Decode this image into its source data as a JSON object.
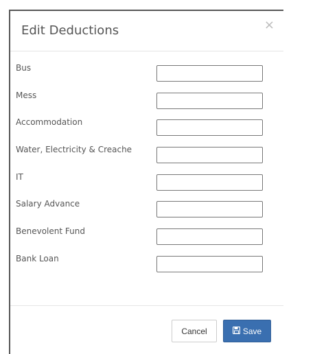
{
  "modal": {
    "title": "Edit Deductions",
    "close_glyph": "×"
  },
  "fields": [
    {
      "label": "Bus",
      "value": ""
    },
    {
      "label": "Mess",
      "value": ""
    },
    {
      "label": "Accommodation",
      "value": ""
    },
    {
      "label": "Water, Electricity & Creache",
      "value": ""
    },
    {
      "label": "IT",
      "value": ""
    },
    {
      "label": "Salary Advance",
      "value": ""
    },
    {
      "label": "Benevolent Fund",
      "value": ""
    },
    {
      "label": "Bank Loan",
      "value": ""
    }
  ],
  "footer": {
    "cancel_label": "Cancel",
    "save_label": "Save",
    "save_icon": "floppy-disk-icon"
  },
  "colors": {
    "primary": "#3a6fb0",
    "border": "#cccccc"
  }
}
